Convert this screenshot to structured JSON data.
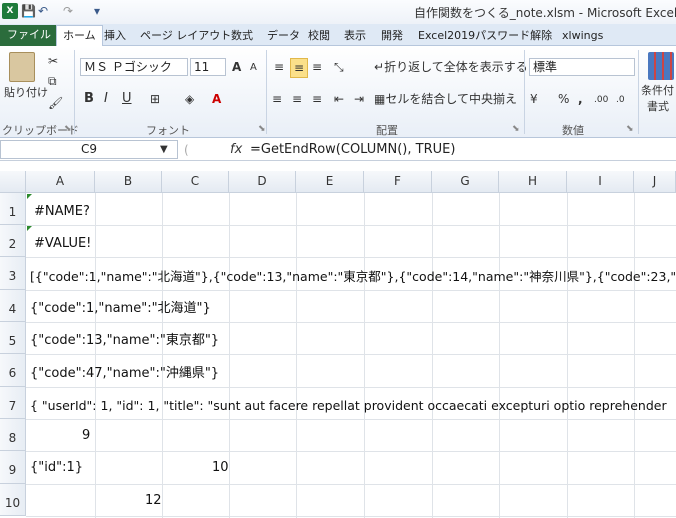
{
  "window": {
    "title": "自作関数をつくる_note.xlsm - Microsoft Excel",
    "app_icon": "X"
  },
  "quick_access": {
    "save": "💾",
    "undo": "↶",
    "redo": "↷",
    "more": "▾"
  },
  "tabs": [
    "ファイル",
    "ホーム",
    "挿入",
    "ページ レイアウト",
    "数式",
    "データ",
    "校閲",
    "表示",
    "開発",
    "Excel2019パスワード解除",
    "xlwings"
  ],
  "ribbon": {
    "clipboard": {
      "paste": "貼り付け",
      "label": "クリップボード"
    },
    "font": {
      "name": "ＭＳ Ｐゴシック",
      "size": "11",
      "bold": "B",
      "italic": "I",
      "underline": "U",
      "grow": "A",
      "shrink": "A",
      "label": "フォント"
    },
    "alignment": {
      "wrap": "折り返して全体を表示する",
      "merge": "セルを結合して中央揃え",
      "label": "配置"
    },
    "number": {
      "format": "標準",
      "percent": "%",
      "comma": ",",
      "inc": ".00",
      "dec": ".0",
      "label": "数値"
    },
    "styles": {
      "cond_format": "条件付",
      "format": "書式"
    }
  },
  "formula_bar": {
    "name_box": "C9",
    "fx": "fx",
    "formula": "=GetEndRow(COLUMN(), TRUE)"
  },
  "grid": {
    "columns": [
      "A",
      "B",
      "C",
      "D",
      "E",
      "F",
      "G",
      "H",
      "I",
      "J"
    ],
    "rows": [
      "1",
      "2",
      "3",
      "4",
      "5",
      "6",
      "7",
      "8",
      "9",
      "10"
    ],
    "cells": {
      "A1": "#NAME?",
      "A2": "#VALUE!",
      "A3": "[{\"code\":1,\"name\":\"北海道\"},{\"code\":13,\"name\":\"東京都\"},{\"code\":14,\"name\":\"神奈川県\"},{\"code\":23,\"",
      "A4": "{\"code\":1,\"name\":\"北海道\"}",
      "A5": "{\"code\":13,\"name\":\"東京都\"}",
      "A6": "{\"code\":47,\"name\":\"沖縄県\"}",
      "A7": "{  \"userId\": 1,  \"id\": 1,  \"title\": \"sunt aut facere repellat provident occaecati excepturi optio reprehender",
      "A8": "9",
      "A9": "{\"id\":1}",
      "C9": "10",
      "B10": "12"
    }
  }
}
